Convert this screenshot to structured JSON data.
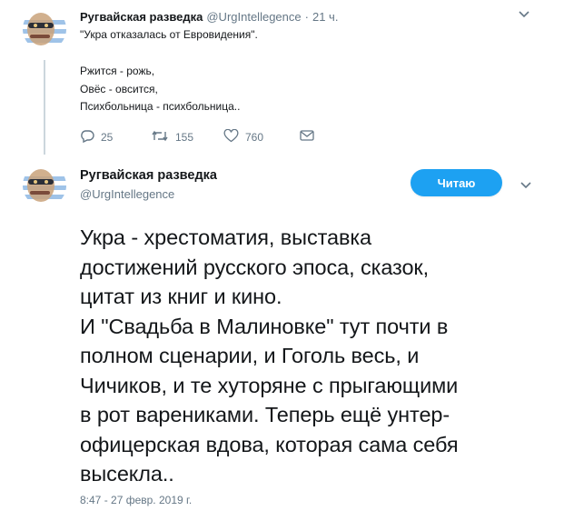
{
  "colors": {
    "accent": "#1da1f2",
    "muted": "#657786",
    "text": "#14171a",
    "thread": "#ccd6dd"
  },
  "reply_tweet": {
    "author_name": "Ругвайская разведка",
    "handle": "@UrgIntellegence",
    "separator": "·",
    "time": "21 ч.",
    "quote_line": "\"Укра отказалась от Евровидения\".",
    "lines": [
      "Ржится - рожь,",
      "Овёс - овсится,",
      "Психбольница - психбольница.."
    ],
    "actions": {
      "replies": "25",
      "retweets": "155",
      "likes": "760"
    }
  },
  "main_tweet": {
    "author_name": "Ругвайская разведка",
    "handle": "@UrgIntellegence",
    "follow_label": "Читаю",
    "text_lines": [
      "Укра - хрестоматия, выставка",
      "достижений русского эпоса, сказок,",
      "цитат из книг и кино.",
      "И \"Свадьба в Малиновке\" тут почти в",
      "полном сценарии, и Гоголь весь, и",
      "Чичиков, и те хуторяне с прыгающими",
      "в рот варениками. Теперь ещё унтер-",
      "офицерская вдова, которая сама себя",
      "высекла.."
    ],
    "timestamp": "8:47 - 27 февр. 2019 г."
  }
}
